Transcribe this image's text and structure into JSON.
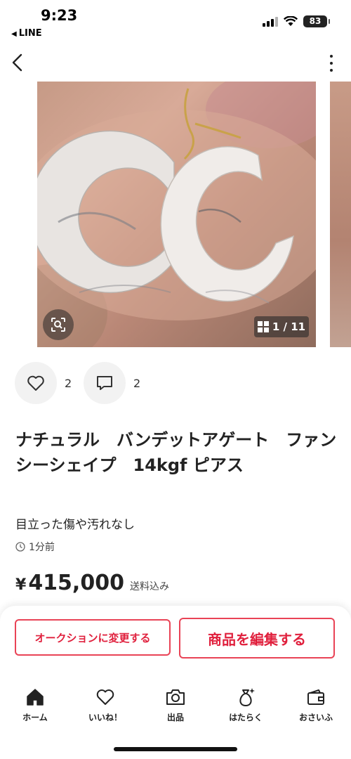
{
  "status_bar": {
    "time": "9:23",
    "back_app": "LINE",
    "battery": "83"
  },
  "carousel": {
    "counter": "1 / 11"
  },
  "social": {
    "likes": "2",
    "comments": "2"
  },
  "item": {
    "title": "ナチュラル　バンデットアゲート　ファンシーシェイプ　14kgf ピアス",
    "condition": "目立った傷や汚れなし",
    "listed_ago": "1分前",
    "price_symbol": "¥",
    "price": "415,000",
    "price_note": "送料込み"
  },
  "actions": {
    "auction_label": "オークションに変更する",
    "edit_label": "商品を編集する"
  },
  "tabs": [
    {
      "label": "ホーム",
      "icon": "home-icon"
    },
    {
      "label": "いいね！",
      "icon": "heart-icon"
    },
    {
      "label": "出品",
      "icon": "camera-icon"
    },
    {
      "label": "はたらく",
      "icon": "money-bag-icon"
    },
    {
      "label": "おさいふ",
      "icon": "wallet-icon"
    }
  ],
  "colors": {
    "accent": "#e0203d"
  }
}
